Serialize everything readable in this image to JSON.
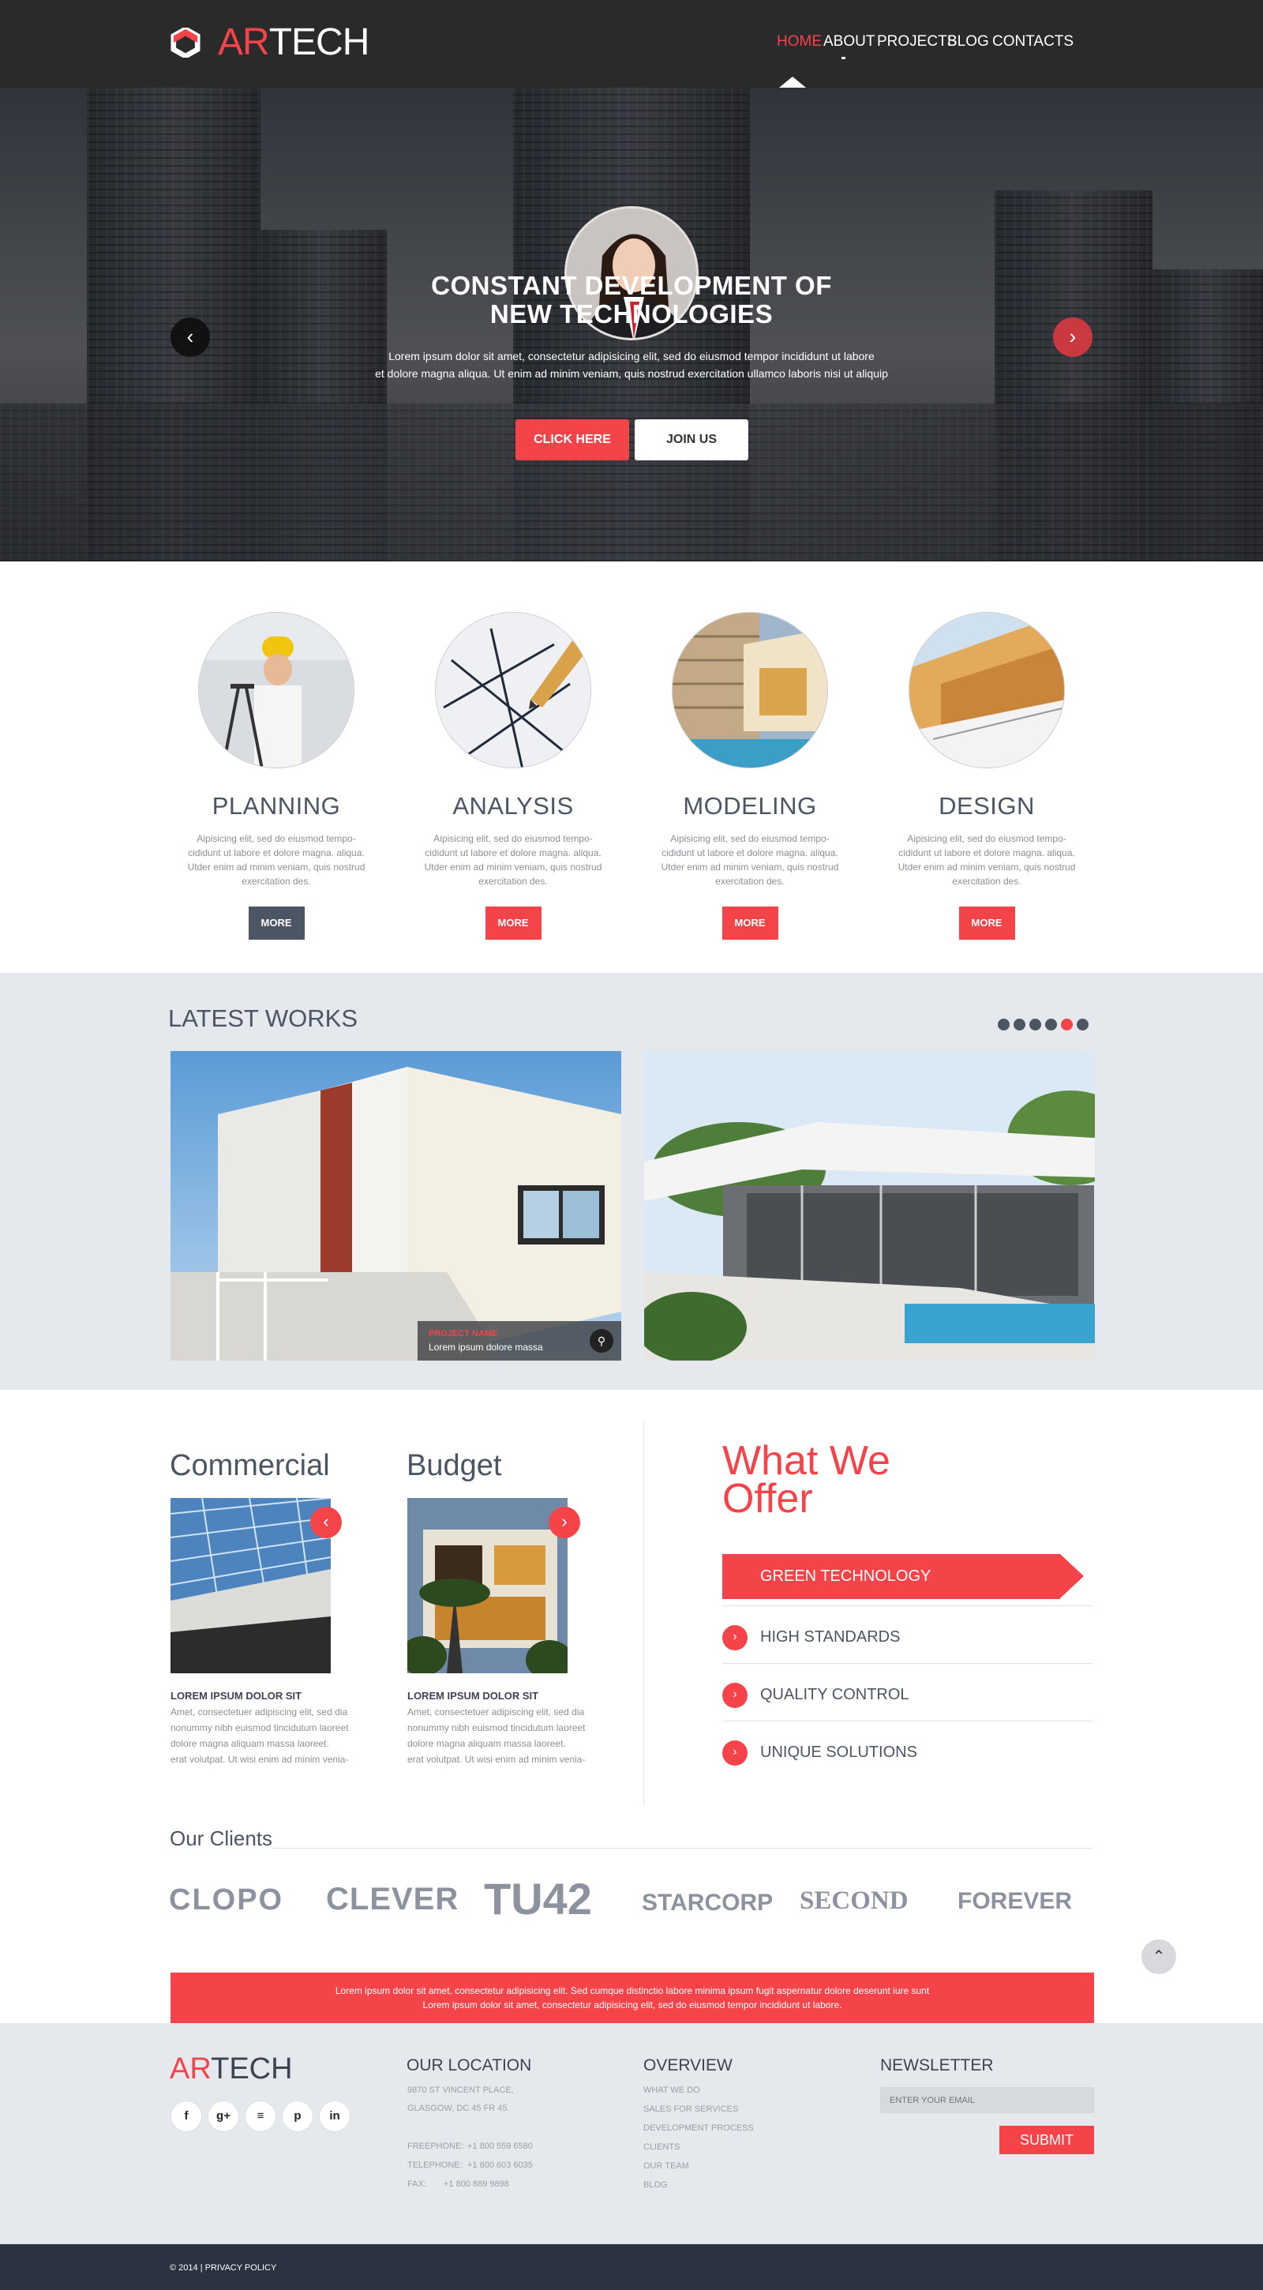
{
  "brand": {
    "ar": "AR",
    "tech": "TECH"
  },
  "nav": [
    {
      "label": "HOME",
      "active": true
    },
    {
      "label": "ABOUT"
    },
    {
      "label": "PROJECTS"
    },
    {
      "label": "BLOG"
    },
    {
      "label": "CONTACTS"
    }
  ],
  "hero": {
    "title_line1": "CONSTANT DEVELOPMENT OF",
    "title_line2": "NEW TECHNOLOGIES",
    "text_line1": "Lorem ipsum dolor sit amet, consectetur adipisicing elit, sed do eiusmod tempor incididunt ut labore",
    "text_line2": "et dolore magna aliqua. Ut enim ad minim veniam, quis nostrud exercitation ullamco laboris nisi ut aliquip",
    "btn_primary": "CLICK HERE",
    "btn_secondary": "JOIN US",
    "prev_icon": "chevron-left-icon",
    "next_icon": "chevron-right-icon"
  },
  "services": [
    {
      "title": "PLANNING",
      "text": "Aipisicing elit, sed do eiusmod tempo-cididunt ut labore et dolore magna. aliqua. Utder enim ad minim veniam, quis nostrud exercitation des.",
      "button": "MORE"
    },
    {
      "title": "ANALYSIS",
      "text": "Aipisicing elit, sed do eiusmod tempo-cididunt ut labore et dolore magna. aliqua. Utder enim ad minim veniam, quis nostrud exercitation des.",
      "button": "MORE"
    },
    {
      "title": "MODELING",
      "text": "Aipisicing elit, sed do eiusmod tempo-cididunt ut labore et dolore magna. aliqua. Utder enim ad minim veniam, quis nostrud exercitation des.",
      "button": "MORE"
    },
    {
      "title": "DESIGN",
      "text": "Aipisicing elit, sed do eiusmod tempo-cididunt ut labore et dolore magna. aliqua. Utder enim ad minim veniam, quis nostrud exercitation des.",
      "button": "MORE"
    }
  ],
  "latest_works": {
    "title": "LATEST WORKS",
    "pager_count": 6,
    "pager_active_index": 4,
    "caption_name": "PROJECT NAME",
    "caption_desc": "Lorem ipsum dolore massa"
  },
  "cards": [
    {
      "title": "Commercial",
      "heading": "LOREM IPSUM DOLOR SIT",
      "text1": "Amet, consectetuer adipiscing elit, sed dia nonummy nibh euismod tincidutum laoreet dolore magna aliquam massa laoreet.",
      "text2": "erat volutpat. Ut wisi enim ad minim venia-"
    },
    {
      "title": "Budget",
      "heading": "LOREM IPSUM DOLOR SIT",
      "text1": "Amet, consectetuer adipiscing elit, sed dia nonummy nibh euismod tincidutum laoreet dolore magna aliquam massa laoreet.",
      "text2": "erat volutpat. Ut wisi enim ad minim venia-"
    }
  ],
  "offer": {
    "title_line1": "What We",
    "title_line2": "Offer",
    "items": [
      "GREEN TECHNOLOGY",
      "HIGH STANDARDS",
      "QUALITY CONTROL",
      "UNIQUE SOLUTIONS"
    ]
  },
  "clients": {
    "title": "Our Clients",
    "logos": [
      "CLOPO",
      "CLEVER",
      "TU42",
      "STARCORP",
      "SECOND",
      "FOREVER"
    ]
  },
  "banner": {
    "line1": "Lorem ipsum dolor sit amet, consectetur adipisicing elit. Sed cumque distinctio labore minima ipsum fugit aspernatur dolore deserunt iure sunt",
    "line2": "Lorem ipsum dolor sit amet, consectetur adipisicing elit, sed do eiusmod tempor incididunt ut labore."
  },
  "footer": {
    "location_title": "OUR LOCATION",
    "address1": "9870 ST VINCENT PLACE,",
    "address2": "GLASGOW, DC 45 FR 45.",
    "freephone_label": "FREEPHONE:",
    "freephone": "+1 800 559 6580",
    "telephone_label": "TELEPHONE:",
    "telephone": "+1 800 603 6035",
    "fax_label": "FAX:",
    "fax": "+1 800 889 9898",
    "overview_title": "OVERVIEW",
    "overview_links": [
      "WHAT WE DO",
      "SALES FOR SERVICES",
      "DEVELOPMENT PROCESS",
      "CLIENTS",
      "OUR TEAM",
      "BLOG"
    ],
    "newsletter_title": "NEWSLETTER",
    "email_placeholder": "ENTER YOUR EMAIL",
    "submit": "SUBMIT",
    "social": [
      {
        "glyph": "f",
        "icon": "facebook-icon"
      },
      {
        "glyph": "g+",
        "icon": "google-plus-icon"
      },
      {
        "glyph": "≡",
        "icon": "rss-icon"
      },
      {
        "glyph": "p",
        "icon": "pinterest-icon"
      },
      {
        "glyph": "in",
        "icon": "linkedin-icon"
      }
    ],
    "copyright": "© 2014 | PRIVACY POLICY"
  },
  "colors": {
    "accent": "#f4444a",
    "dark": "#2a2a2b",
    "slate": "#4c5563",
    "light_bg": "#e5e8ec"
  }
}
